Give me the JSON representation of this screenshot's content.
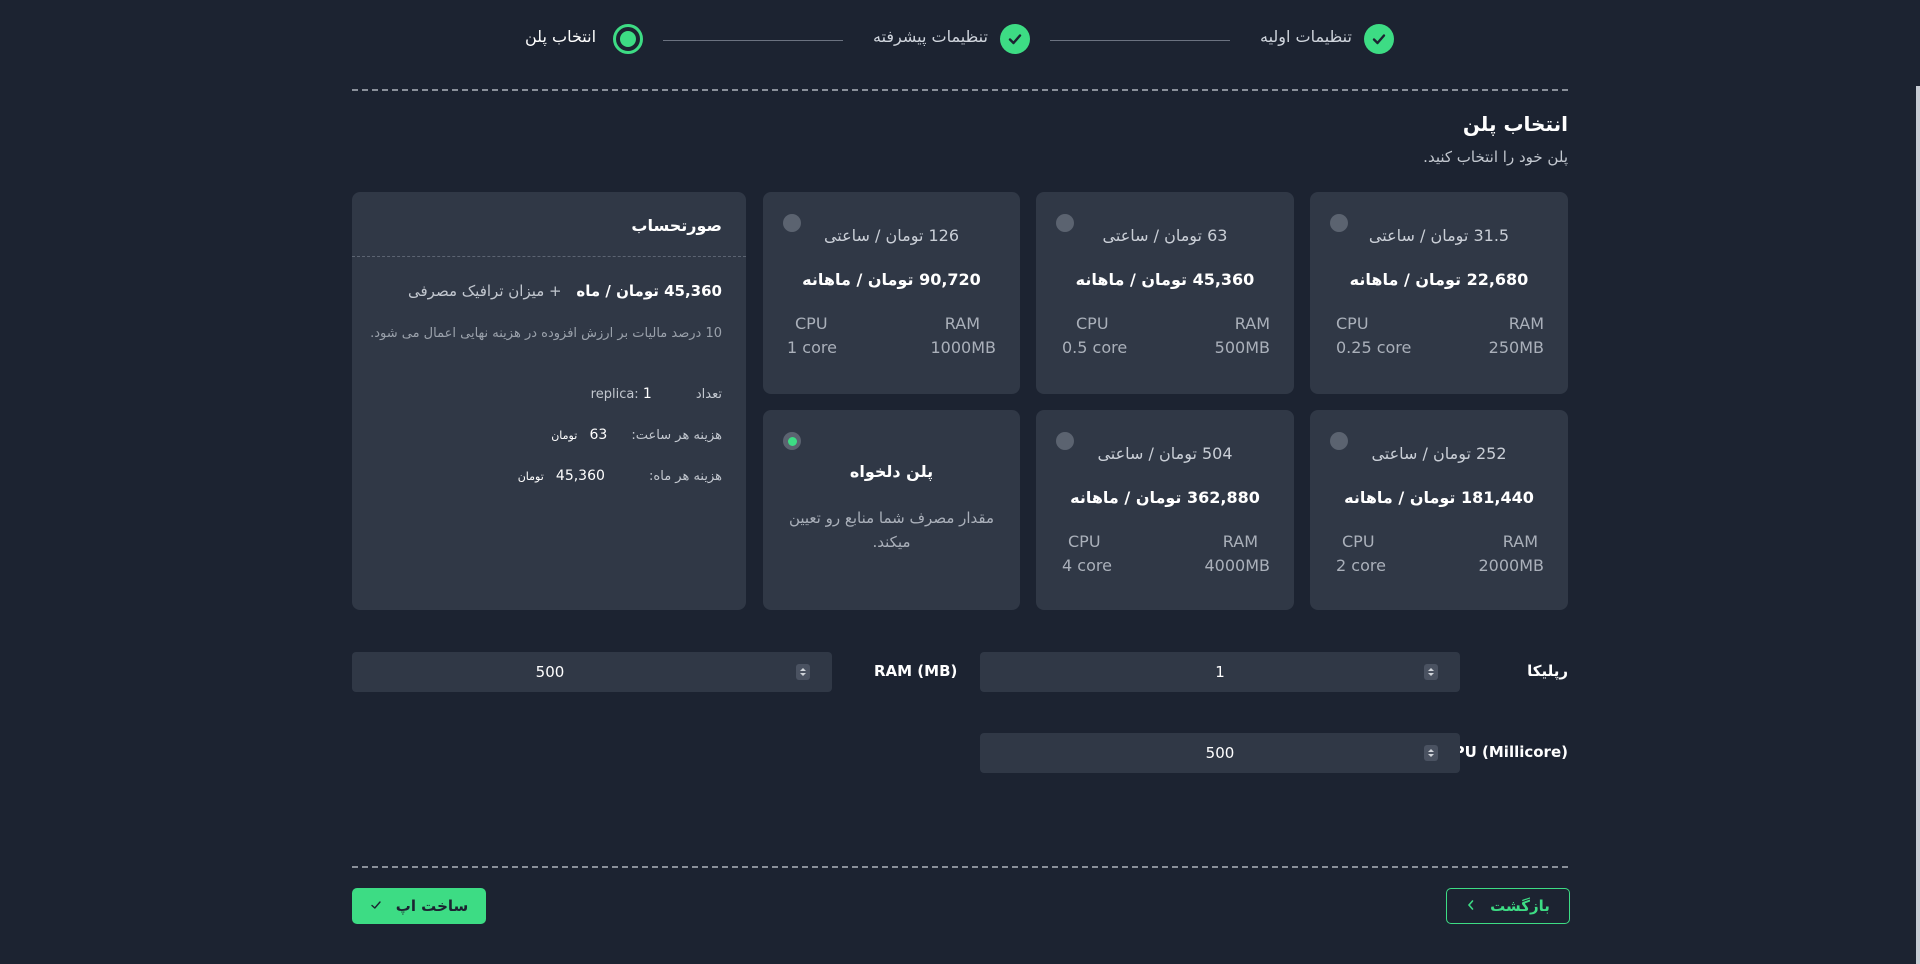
{
  "stepper": {
    "steps": [
      {
        "label": "تنظیمات اولیه",
        "status": "done"
      },
      {
        "label": "تنظیمات پیشرفته",
        "status": "done"
      },
      {
        "label": "انتخاب پلن",
        "status": "current"
      }
    ]
  },
  "header": {
    "title": "انتخاب پلن",
    "subtitle": "پلن خود را انتخاب کنید."
  },
  "plans": [
    {
      "hourly": "31.5 تومان / ساعتی",
      "monthly": "22,680 تومان / ماهانه",
      "ram_label": "RAM",
      "ram": "250MB",
      "cpu_label": "CPU",
      "cpu": "0.25 core"
    },
    {
      "hourly": "63 تومان / ساعتی",
      "monthly": "45,360 تومان / ماهانه",
      "ram_label": "RAM",
      "ram": "500MB",
      "cpu_label": "CPU",
      "cpu": "0.5 core"
    },
    {
      "hourly": "126 تومان / ساعتی",
      "monthly": "90,720 تومان / ماهانه",
      "ram_label": "RAM",
      "ram": "1000MB",
      "cpu_label": "CPU",
      "cpu": "1 core"
    },
    {
      "hourly": "252 تومان / ساعتی",
      "monthly": "181,440 تومان / ماهانه",
      "ram_label": "RAM",
      "ram": "2000MB",
      "cpu_label": "CPU",
      "cpu": "2 core"
    },
    {
      "hourly": "504 تومان / ساعتی",
      "monthly": "362,880 تومان / ماهانه",
      "ram_label": "RAM",
      "ram": "4000MB",
      "cpu_label": "CPU",
      "cpu": "4 core"
    }
  ],
  "custom_plan": {
    "title": "پلن دلخواه",
    "description": "مقدار مصرف شما منابع رو تعیین میکند.",
    "selected": true
  },
  "invoice": {
    "title": "صورتحساب",
    "price": "45,360 تومان / ماه",
    "traffic": "+ میزان ترافیک مصرفی",
    "tax_note": "10 درصد مالیات بر ارزش افزوده در هزینه نهایی اعمال می شود.",
    "replica_label": "تعداد replica:",
    "replica_value": "1",
    "hourly_label": "هزینه هر ساعت:",
    "hourly_value": "63",
    "hourly_unit": "تومان",
    "monthly_label": "هزینه هر ماه:",
    "monthly_value": "45,360",
    "monthly_unit": "تومان"
  },
  "fields": {
    "replica_label": "رپلیکا",
    "replica_value": "1",
    "ram_label": "RAM (MB)",
    "ram_value": "500",
    "cpu_label": "CPU (Millicore)",
    "cpu_value": "500"
  },
  "buttons": {
    "back": "بازگشت",
    "create": "ساخت اپ"
  },
  "colors": {
    "accent": "#3ddc84",
    "background": "#1c2331",
    "card": "#303846"
  }
}
